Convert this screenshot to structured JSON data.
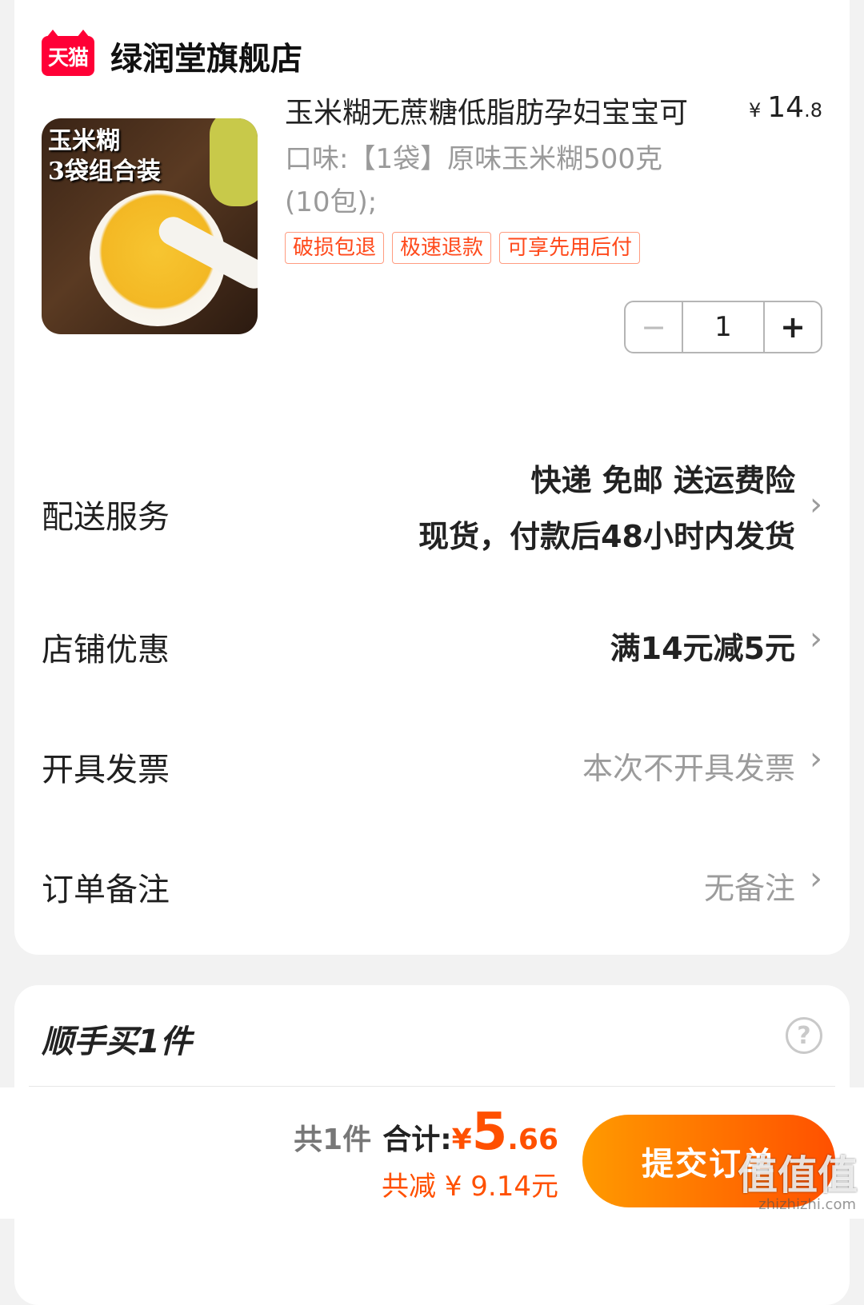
{
  "store": {
    "logo_text": "天猫",
    "name": "绿润堂旗舰店"
  },
  "product": {
    "image_text_line1": "玉米糊",
    "image_text_line2": "3袋组合装",
    "title": "玉米糊无蔗糖低脂肪孕妇宝宝可",
    "price_symbol": "¥",
    "price_int": "14",
    "price_dec": ".8",
    "spec": "口味:【1袋】原味玉米糊500克(10包);",
    "tags": [
      "破损包退",
      "极速退款",
      "可享先用后付"
    ],
    "quantity": "1",
    "minus_label": "−",
    "plus_label": "+"
  },
  "rows": {
    "delivery": {
      "label": "配送服务",
      "value_line1": "快递 免邮 送运费险",
      "value_line2": "现货，付款后48小时内发货"
    },
    "promo": {
      "label": "店铺优惠",
      "value": "满14元减5元"
    },
    "invoice": {
      "label": "开具发票",
      "value": "本次不开具发票"
    },
    "note": {
      "label": "订单备注",
      "value": "无备注"
    },
    "chevron": "›"
  },
  "addon": {
    "title": "顺手买1件",
    "help": "?"
  },
  "summary": {
    "count": "共1件",
    "total_label": "合计:",
    "currency": "¥",
    "total_int": "5",
    "total_dec": ".66",
    "discount": "共减 ¥ 9.14元"
  },
  "submit_label": "提交订单",
  "watermark": {
    "main": "值值值",
    "sub": "zhizhizhi.com"
  },
  "colors": {
    "accent": "#ff5000",
    "tmall_red": "#ff0036",
    "muted": "#9b9b9b"
  }
}
